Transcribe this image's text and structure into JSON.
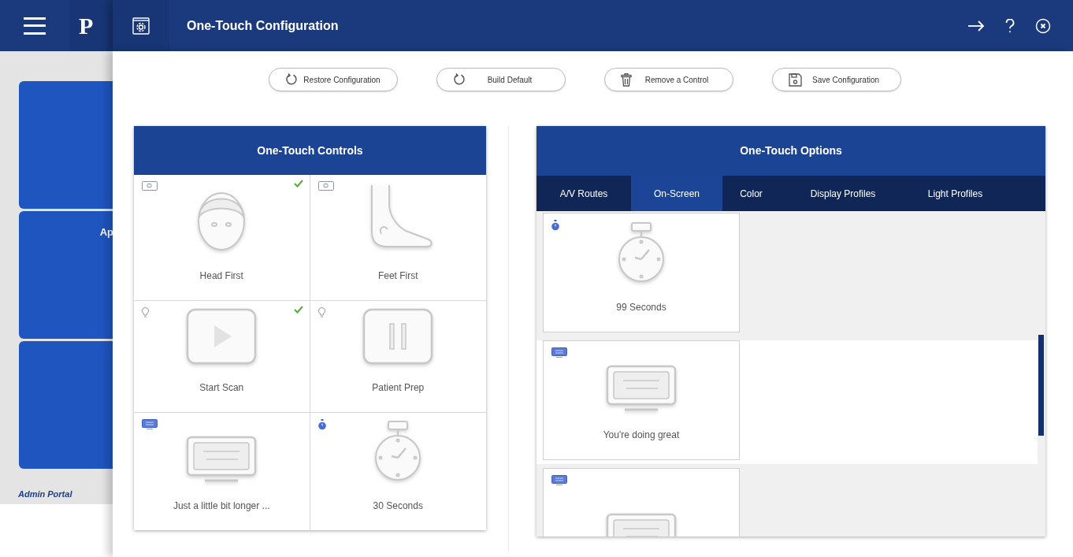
{
  "app_bar": {
    "logo": "P",
    "title": "One-Touch Configuration"
  },
  "sidebar": {
    "tiles": [
      {
        "kind": "tile"
      },
      {
        "kind": "tile",
        "label": "Ap"
      },
      {
        "kind": "tile"
      }
    ],
    "footer": "Admin Portal"
  },
  "toolbar": [
    {
      "kind": "restore",
      "label": "Restore Configuration"
    },
    {
      "kind": "restore",
      "label": "Build Default"
    },
    {
      "kind": "trash",
      "label": "Remove a Control"
    },
    {
      "kind": "save",
      "label": "Save Configuration"
    }
  ],
  "controls_panel": {
    "title": "One-Touch Controls",
    "items": [
      {
        "kind": "head",
        "label": "Head First",
        "checked": true
      },
      {
        "kind": "foot",
        "label": "Feet First",
        "checked": false
      },
      {
        "kind": "play",
        "label": "Start Scan",
        "checked": true
      },
      {
        "kind": "pause",
        "label": "Patient Prep",
        "checked": false
      },
      {
        "kind": "monitor",
        "label": "Just a little bit longer ...",
        "checked": false
      },
      {
        "kind": "stopwatch",
        "label": "30 Seconds",
        "checked": false
      }
    ]
  },
  "options_panel": {
    "title": "One-Touch Options",
    "tabs": [
      {
        "label": "A/V Routes",
        "selected": false
      },
      {
        "label": "On-Screen",
        "selected": true
      },
      {
        "label": "Color",
        "selected": false
      },
      {
        "label": "Display Profiles",
        "selected": false
      },
      {
        "label": "Light Profiles",
        "selected": false
      }
    ],
    "items": [
      {
        "kind": "stopwatch",
        "label": "99 Seconds",
        "selected": false
      },
      {
        "kind": "monitor",
        "label": "You're doing great",
        "selected": true
      },
      {
        "kind": "monitor",
        "selected": false
      }
    ]
  }
}
